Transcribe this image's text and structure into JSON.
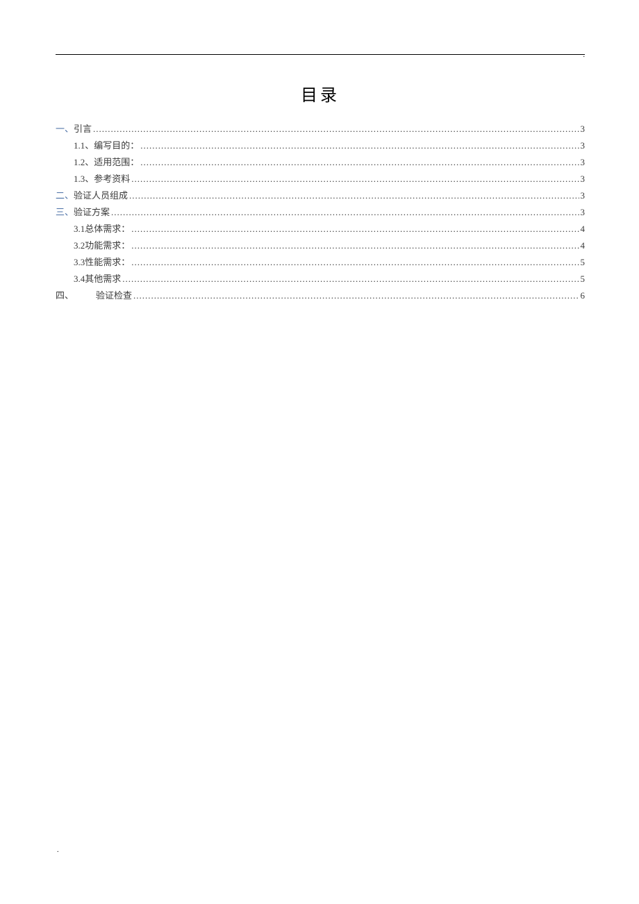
{
  "title": "目录",
  "toc": [
    {
      "level": 1,
      "prefix": "一、",
      "label": "引言",
      "page": "3",
      "link": true,
      "special": false
    },
    {
      "level": 2,
      "prefix": "1.1、",
      "label": "编写目的：",
      "page": "3",
      "link": false,
      "special": false
    },
    {
      "level": 2,
      "prefix": "1.2、",
      "label": "适用范围：",
      "page": "3",
      "link": false,
      "special": false
    },
    {
      "level": 2,
      "prefix": "1.3、",
      "label": "参考资料",
      "page": "3",
      "link": false,
      "special": false
    },
    {
      "level": 1,
      "prefix": "二、",
      "label": "验证人员组成",
      "page": "3",
      "link": true,
      "special": false
    },
    {
      "level": 1,
      "prefix": "三、",
      "label": "验证方案",
      "page": "3",
      "link": true,
      "special": false
    },
    {
      "level": 2,
      "prefix": "3.1 ",
      "label": "总体需求：",
      "page": "4",
      "link": false,
      "special": false
    },
    {
      "level": 2,
      "prefix": "3.2 ",
      "label": "功能需求：",
      "page": "4",
      "link": false,
      "special": false
    },
    {
      "level": 2,
      "prefix": "3.3 ",
      "label": "性能需求：",
      "page": "5",
      "link": false,
      "special": false
    },
    {
      "level": 2,
      "prefix": "3.4 ",
      "label": "其他需求",
      "page": "5",
      "link": false,
      "special": false
    },
    {
      "level": 1,
      "prefix": "四、",
      "label": "验证检查",
      "page": "6",
      "link": false,
      "special": true
    }
  ]
}
